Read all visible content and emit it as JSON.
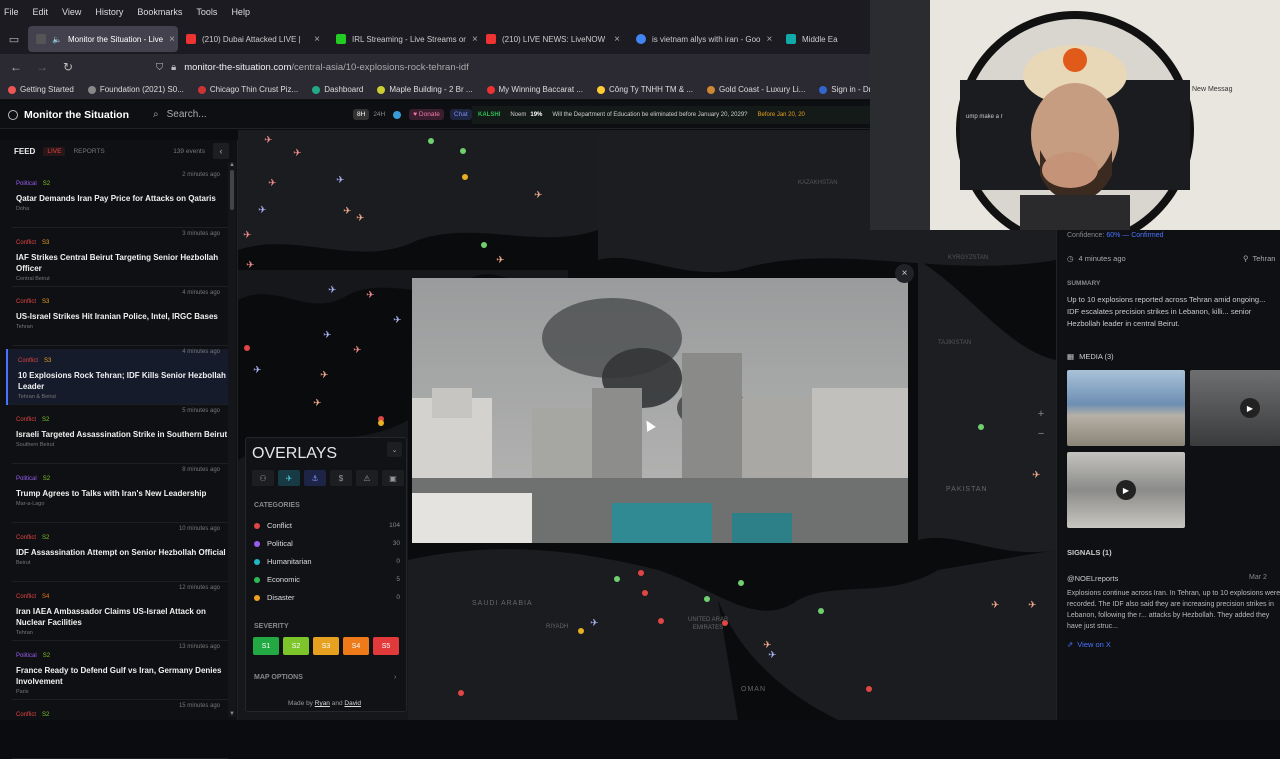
{
  "menubar": [
    "File",
    "Edit",
    "View",
    "History",
    "Bookmarks",
    "Tools",
    "Help"
  ],
  "tabs": [
    {
      "label": "Monitor the Situation - Live",
      "color": "#444",
      "active": true
    },
    {
      "label": "(210) Dubai Attacked LIVE |",
      "color": "#e33"
    },
    {
      "label": "IRL Streaming - Live Streams or",
      "color": "#2c2"
    },
    {
      "label": "(210) LIVE NEWS: LiveNOW",
      "color": "#e33"
    },
    {
      "label": "is vietnam allys with iran - Goo",
      "color": "#4285f4"
    },
    {
      "label": "Middle East",
      "color": "#1aa"
    }
  ],
  "url": {
    "host": "monitor-the-situation.com",
    "path": "/central-asia/10-explosions-rock-tehran-idf"
  },
  "bookmarks": [
    {
      "label": "Getting Started",
      "color": "#e55"
    },
    {
      "label": "Foundation (2021) S0...",
      "color": "#888"
    },
    {
      "label": "Chicago Thin Crust Piz...",
      "color": "#c33"
    },
    {
      "label": "Dashboard",
      "color": "#2a8"
    },
    {
      "label": "Maple Building - 2 Br ...",
      "color": "#cc3"
    },
    {
      "label": "My Winning Baccarat ...",
      "color": "#e33"
    },
    {
      "label": "Công Ty TNHH TM & ...",
      "color": "#fc3"
    },
    {
      "label": "Gold Coast - Luxury Li...",
      "color": "#c83"
    },
    {
      "label": "Sign in - Drea",
      "color": "#36c"
    }
  ],
  "app": {
    "brand": "Monitor the Situation",
    "search_placeholder": "Search...",
    "range_8h": "8H",
    "range_24h": "24H",
    "donate": "♥ Donate",
    "chat": "Chat",
    "ticker_source": "KALSHI",
    "ticker_label": "Noem",
    "ticker_pct": "19%",
    "ticker_question": "Will the Department of Education be eliminated before January 20, 2029?",
    "ticker_tail": "Before Jan 20, 20"
  },
  "feed": {
    "title": "FEED",
    "live": "LIVE",
    "reports": "REPORTS",
    "count": "139 events",
    "items": [
      {
        "cat": "Political",
        "sev": "S2",
        "time": "2 minutes ago",
        "title": "Qatar Demands Iran Pay Price for Attacks on Qataris",
        "loc": "Doha"
      },
      {
        "cat": "Conflict",
        "sev": "S3",
        "time": "3 minutes ago",
        "title": "IAF Strikes Central Beirut Targeting Senior Hezbollah Officer",
        "loc": "Central Beirut"
      },
      {
        "cat": "Conflict",
        "sev": "S3",
        "time": "4 minutes ago",
        "title": "US-Israel Strikes Hit Iranian Police, Intel, IRGC Bases",
        "loc": "Tehran"
      },
      {
        "cat": "Conflict",
        "sev": "S3",
        "time": "4 minutes ago",
        "title": "10 Explosions Rock Tehran; IDF Kills Senior Hezbollah Leader",
        "loc": "Tehran & Beirut"
      },
      {
        "cat": "Conflict",
        "sev": "S2",
        "time": "5 minutes ago",
        "title": "Israeli Targeted Assassination Strike in Southern Beirut",
        "loc": "Southern Beirut"
      },
      {
        "cat": "Political",
        "sev": "S2",
        "time": "8 minutes ago",
        "title": "Trump Agrees to Talks with Iran's New Leadership",
        "loc": "Mar-a-Lago"
      },
      {
        "cat": "Conflict",
        "sev": "S2",
        "time": "10 minutes ago",
        "title": "IDF Assassination Attempt on Senior Hezbollah Official",
        "loc": "Beirut"
      },
      {
        "cat": "Conflict",
        "sev": "S4",
        "time": "12 minutes ago",
        "title": "Iran IAEA Ambassador Claims US-Israel Attack on Nuclear Facilities",
        "loc": "Tehran"
      },
      {
        "cat": "Political",
        "sev": "S2",
        "time": "13 minutes ago",
        "title": "France Ready to Defend Gulf vs Iran, Germany Denies Involvement",
        "loc": "Paris"
      },
      {
        "cat": "Conflict",
        "sev": "S2",
        "time": "15 minutes ago",
        "title": "",
        "loc": ""
      }
    ]
  },
  "overlays": {
    "title": "OVERLAYS",
    "categories_title": "CATEGORIES",
    "categories": [
      {
        "label": "Conflict",
        "count": "104",
        "color": "#e24545"
      },
      {
        "label": "Political",
        "count": "30",
        "color": "#9a5cf0"
      },
      {
        "label": "Humanitarian",
        "count": "0",
        "color": "#22b8c8"
      },
      {
        "label": "Economic",
        "count": "5",
        "color": "#2dbb55"
      },
      {
        "label": "Disaster",
        "count": "0",
        "color": "#f0a020"
      }
    ],
    "severity_title": "SEVERITY",
    "severity": [
      {
        "label": "S1",
        "color": "#22a944"
      },
      {
        "label": "S2",
        "color": "#7cc52a"
      },
      {
        "label": "S3",
        "color": "#e8a020"
      },
      {
        "label": "S4",
        "color": "#ee7a1a"
      },
      {
        "label": "S5",
        "color": "#e23a3a"
      }
    ],
    "map_options": "MAP OPTIONS",
    "credit_prefix": "Made by",
    "credit_a": "Ryan",
    "credit_and": "and",
    "credit_b": "David"
  },
  "map_labels": {
    "saudi": "SAUDI ARABIA",
    "riyadh": "RIYADH",
    "uae": "UNITED ARAB EMIRATES",
    "oman": "OMAN",
    "pakistan": "PAKISTAN",
    "tajikistan": "TAJIKISTAN",
    "kyrgyzstan": "KYRGYZSTAN",
    "kazakhstan": "KAZAKHSTAN"
  },
  "detail": {
    "confidence_label": "Confidence:",
    "confidence_value": "60% — Confirmed",
    "time": "4 minutes ago",
    "location": "Tehran",
    "summary_title": "SUMMARY",
    "summary": "Up to 10 explosions reported across Tehran amid ongoing... IDF escalates precision strikes in Lebanon, killi... senior Hezbollah leader in central Beirut.",
    "media_title": "MEDIA (3)",
    "signals_title": "SIGNALS (1)",
    "signal_source": "@NOELreports",
    "signal_date": "Mar 2",
    "signal_text": "Explosions continue across Iran. In Tehran, up to 10 explosions were recorded. The IDF also said they are increasing precision strikes in Lebanon, following the r... attacks by Hezbollah. They added they have just struc...",
    "view_link": "View on X"
  },
  "webcam": {
    "side_text": "New Messag",
    "overlay_text": "ump make a r"
  }
}
